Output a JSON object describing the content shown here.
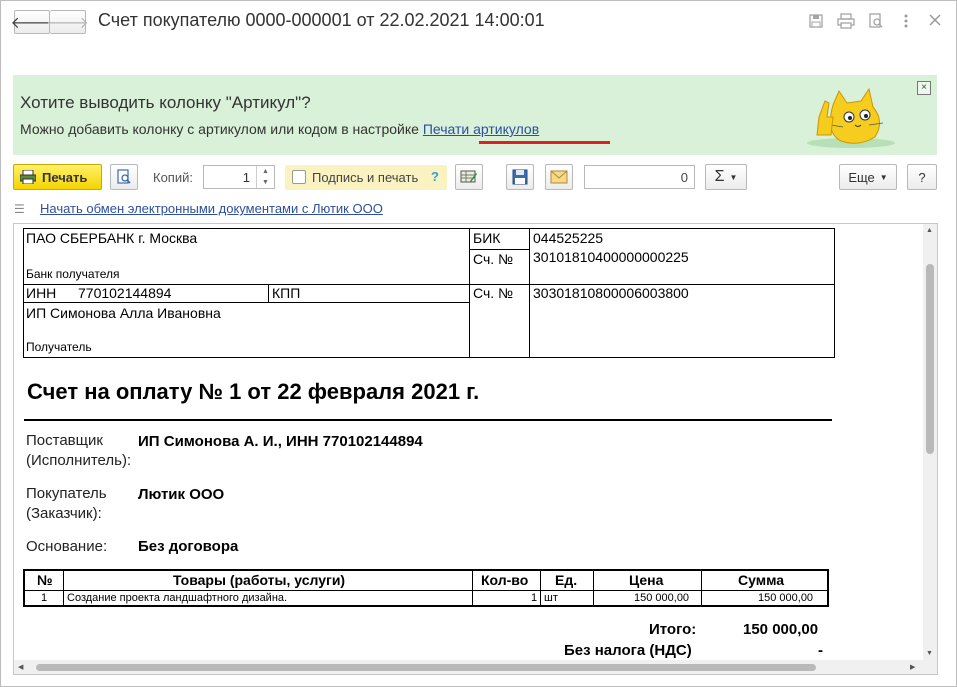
{
  "window": {
    "title": "Счет покупателю 0000-000001 от 22.02.2021 14:00:01",
    "back_glyph": "🡐",
    "forward_glyph": "🡒"
  },
  "banner": {
    "question": "Хотите выводить колонку \"Артикул\"?",
    "text": "Можно добавить колонку с артикулом или кодом в настройке ",
    "link": "Печати артикулов",
    "close_glyph": "×"
  },
  "toolbar": {
    "print_label": "Печать",
    "copies_label": "Копий:",
    "copies_value": "1",
    "sign_label": "Подпись и печать",
    "sign_help": "?",
    "number_value": "0",
    "sum_glyph": "Σ",
    "more_label": "Еще",
    "help_label": "?"
  },
  "edo_link": "Начать обмен электронными документами с Лютик ООО",
  "bank": {
    "bank_name": "ПАО СБЕРБАНК г. Москва",
    "bank_caption": "Банк получателя",
    "bik_label": "БИК",
    "bik_value": "044525225",
    "corr_label": "Сч. №",
    "corr_value": "30101810400000000225",
    "inn_label": "ИНН",
    "inn_value": "770102144894",
    "kpp_label": "КПП",
    "recipient_name": "ИП Симонова Алла Ивановна",
    "recipient_caption": "Получатель",
    "acc_label": "Сч. №",
    "acc_value": "30301810800006003800"
  },
  "invoice": {
    "title": "Счет на оплату № 1 от 22 февраля 2021 г.",
    "supplier_label_1": "Поставщик",
    "supplier_label_2": "(Исполнитель):",
    "supplier_value": "ИП Симонова А. И., ИНН 770102144894",
    "buyer_label_1": "Покупатель",
    "buyer_label_2": "(Заказчик):",
    "buyer_value": "Лютик ООО",
    "basis_label": "Основание:",
    "basis_value": "Без договора"
  },
  "table": {
    "headers": [
      "№",
      "Товары (работы, услуги)",
      "Кол-во",
      "Ед.",
      "Цена",
      "Сумма"
    ],
    "rows": [
      [
        "1",
        "Создание проекта ландшафтного дизайна.",
        "1",
        "шт",
        "150 000,00",
        "150 000,00"
      ]
    ]
  },
  "totals": {
    "total_label": "Итого:",
    "total_value": "150 000,00",
    "vat_label": "Без налога (НДС)",
    "vat_value": "-"
  },
  "colors": {
    "banner_bg": "#d9f0d9",
    "print_button": "#f5d400",
    "link": "#2d4f9d",
    "highlight_underline": "#e02020"
  }
}
